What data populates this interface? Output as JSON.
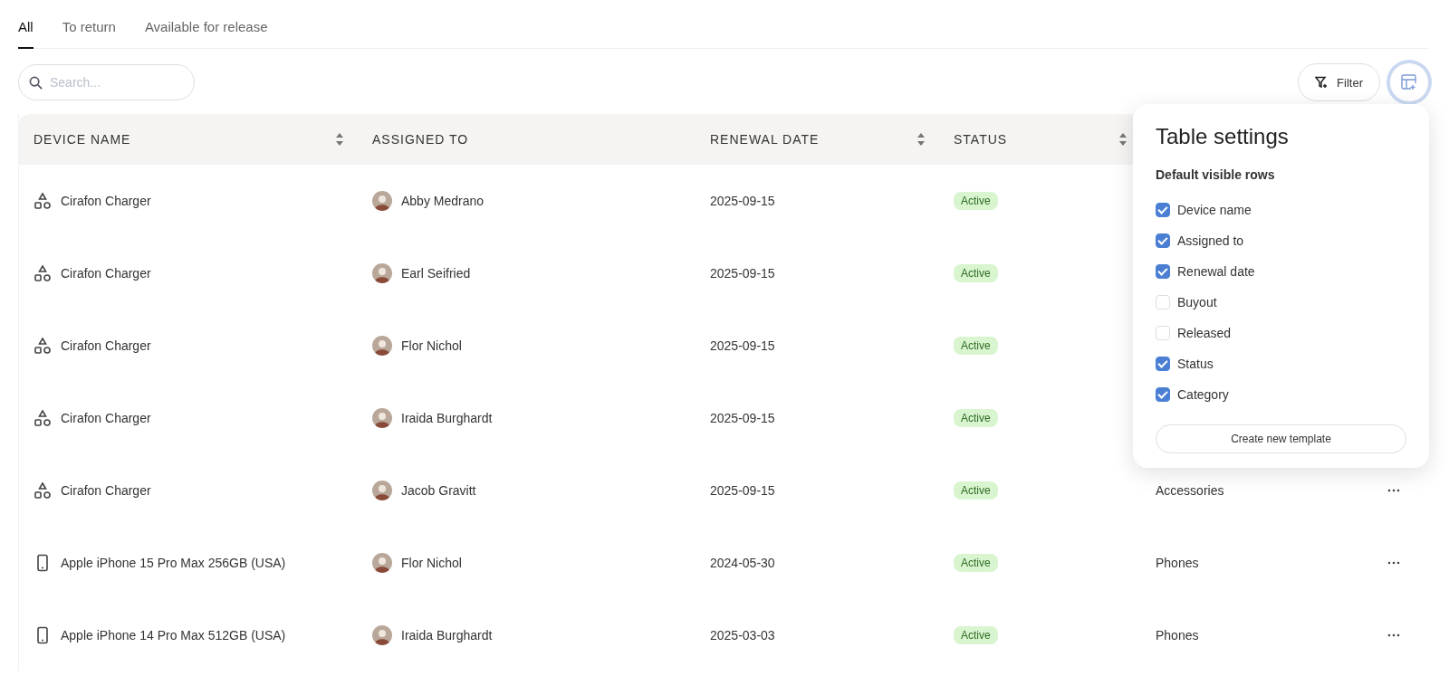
{
  "tabs": [
    {
      "label": "All",
      "selected": true
    },
    {
      "label": "To return",
      "selected": false
    },
    {
      "label": "Available for release",
      "selected": false
    }
  ],
  "search": {
    "placeholder": "Search..."
  },
  "filter_button": {
    "label": "Filter"
  },
  "table": {
    "columns": [
      {
        "label": "DEVICE NAME",
        "sortable": true
      },
      {
        "label": "ASSIGNED TO",
        "sortable": false
      },
      {
        "label": "RENEWAL DATE",
        "sortable": true
      },
      {
        "label": "STATUS",
        "sortable": true
      }
    ],
    "rows": [
      {
        "kind": "accessory",
        "device": "Cirafon Charger",
        "assigned_to": "Abby Medrano",
        "renewal_date": "2025-09-15",
        "status": "Active"
      },
      {
        "kind": "accessory",
        "device": "Cirafon Charger",
        "assigned_to": "Earl Seifried",
        "renewal_date": "2025-09-15",
        "status": "Active"
      },
      {
        "kind": "accessory",
        "device": "Cirafon Charger",
        "assigned_to": "Flor Nichol",
        "renewal_date": "2025-09-15",
        "status": "Active"
      },
      {
        "kind": "accessory",
        "device": "Cirafon Charger",
        "assigned_to": "Iraida Burghardt",
        "renewal_date": "2025-09-15",
        "status": "Active"
      },
      {
        "kind": "accessory",
        "device": "Cirafon Charger",
        "assigned_to": "Jacob Gravitt",
        "renewal_date": "2025-09-15",
        "status": "Active",
        "category": "Accessories"
      },
      {
        "kind": "phone",
        "device": "Apple iPhone 15 Pro Max 256GB (USA)",
        "assigned_to": "Flor Nichol",
        "renewal_date": "2024-05-30",
        "status": "Active",
        "category": "Phones"
      },
      {
        "kind": "phone",
        "device": "Apple iPhone 14 Pro Max 512GB (USA)",
        "assigned_to": "Iraida Burghardt",
        "renewal_date": "2025-03-03",
        "status": "Active",
        "category": "Phones"
      }
    ]
  },
  "table_settings": {
    "title": "Table settings",
    "subtitle": "Default visible rows",
    "options": [
      {
        "label": "Device name",
        "checked": true
      },
      {
        "label": "Assigned to",
        "checked": true
      },
      {
        "label": "Renewal date",
        "checked": true
      },
      {
        "label": "Buyout",
        "checked": false
      },
      {
        "label": "Released",
        "checked": false
      },
      {
        "label": "Status",
        "checked": true
      },
      {
        "label": "Category",
        "checked": true
      }
    ],
    "button": "Create new template"
  }
}
